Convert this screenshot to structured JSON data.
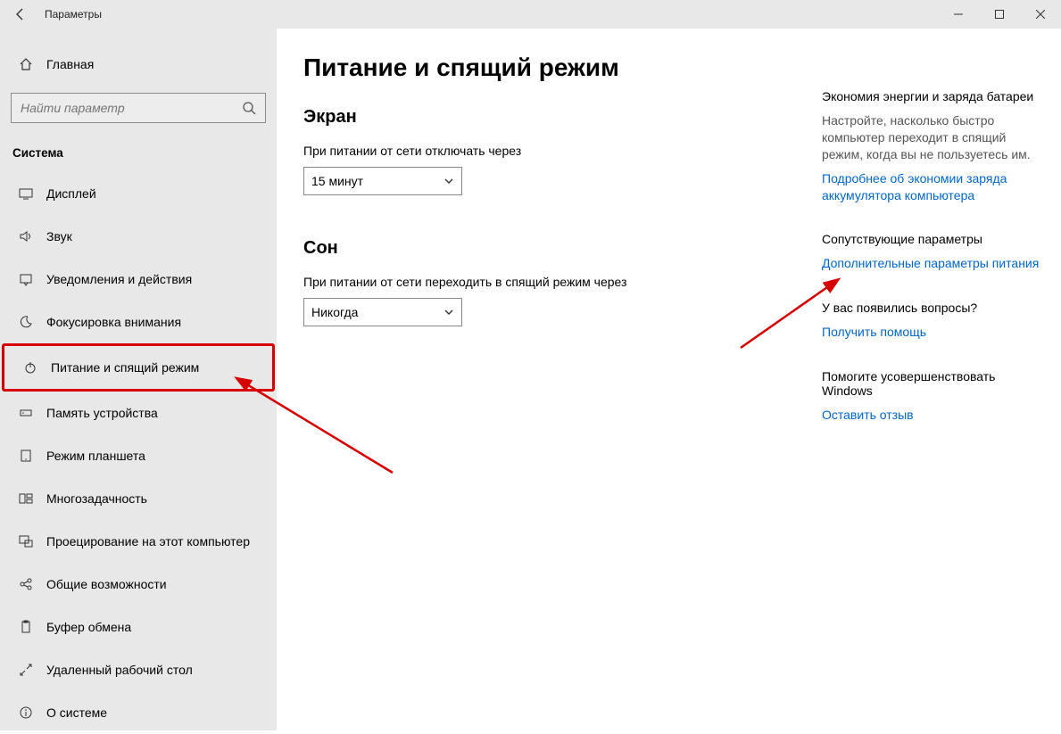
{
  "window": {
    "title": "Параметры"
  },
  "sidebar": {
    "home": "Главная",
    "search_placeholder": "Найти параметр",
    "section": "Система",
    "items": [
      {
        "label": "Дисплей"
      },
      {
        "label": "Звук"
      },
      {
        "label": "Уведомления и действия"
      },
      {
        "label": "Фокусировка внимания"
      },
      {
        "label": "Питание и спящий режим"
      },
      {
        "label": "Память устройства"
      },
      {
        "label": "Режим планшета"
      },
      {
        "label": "Многозадачность"
      },
      {
        "label": "Проецирование на этот компьютер"
      },
      {
        "label": "Общие возможности"
      },
      {
        "label": "Буфер обмена"
      },
      {
        "label": "Удаленный рабочий стол"
      },
      {
        "label": "О системе"
      }
    ]
  },
  "main": {
    "title": "Питание и спящий режим",
    "screen_h": "Экран",
    "screen_label": "При питании от сети отключать через",
    "screen_value": "15 минут",
    "sleep_h": "Сон",
    "sleep_label": "При питании от сети переходить в спящий режим через",
    "sleep_value": "Никогда"
  },
  "right": {
    "b1_h": "Экономия энергии и заряда батареи",
    "b1_t": "Настройте, насколько быстро компьютер переходит в спящий режим, когда вы не пользуетесь им.",
    "b1_l": "Подробнее об экономии заряда аккумулятора компьютера",
    "b2_h": "Сопутствующие параметры",
    "b2_l": "Дополнительные параметры питания",
    "b3_h": "У вас появились вопросы?",
    "b3_l": "Получить помощь",
    "b4_h": "Помогите усовершенствовать Windows",
    "b4_l": "Оставить отзыв"
  }
}
